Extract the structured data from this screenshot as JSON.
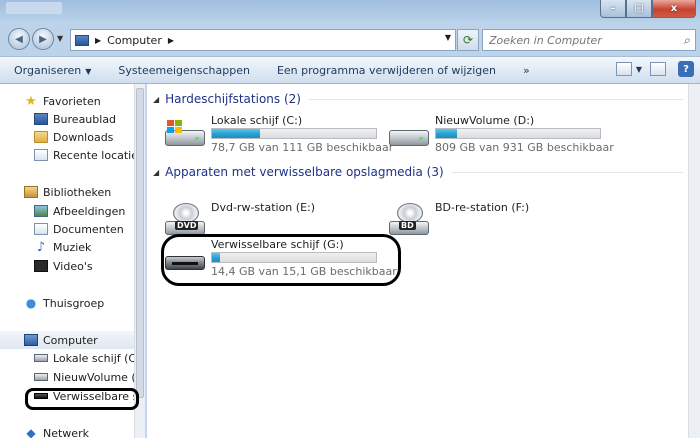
{
  "window": {
    "caption_buttons": {
      "minimize": "–",
      "maximize": "□",
      "close": "x"
    }
  },
  "address_bar": {
    "location": "Computer",
    "search_placeholder": "Zoeken in Computer"
  },
  "toolbar": {
    "organize": "Organiseren",
    "system_properties": "Systeemeigenschappen",
    "uninstall": "Een programma verwijderen of wijzigen",
    "more": "»",
    "help": "?"
  },
  "nav": {
    "favorites": "Favorieten",
    "desktop": "Bureaublad",
    "downloads": "Downloads",
    "recent": "Recente locaties",
    "libraries": "Bibliotheken",
    "pictures": "Afbeeldingen",
    "documents": "Documenten",
    "music": "Muziek",
    "videos": "Video's",
    "homegroup": "Thuisgroep",
    "computer": "Computer",
    "local_disk": "Lokale schijf (C:)",
    "new_volume": "NieuwVolume (D",
    "removable": "Verwisselbare sch",
    "network": "Netwerk"
  },
  "content": {
    "hdd_header": "Hardeschijfstations (2)",
    "removable_header": "Apparaten met verwisselbare opslagmedia (3)",
    "drives": [
      {
        "name": "Lokale schijf (C:)",
        "free_text": "78,7 GB van 111 GB beschikbaar",
        "used_fraction": 0.29
      },
      {
        "name": "NieuwVolume (D:)",
        "free_text": "809 GB van 931 GB beschikbaar",
        "used_fraction": 0.13
      },
      {
        "name": "Dvd-rw-station (E:)",
        "icon_label": "DVD"
      },
      {
        "name": "BD-re-station (F:)",
        "icon_label": "BD"
      },
      {
        "name": "Verwisselbare schijf (G:)",
        "free_text": "14,4 GB van 15,1 GB beschikbaar",
        "used_fraction": 0.05
      }
    ]
  },
  "colors": {
    "bar_fill": "#25a1d1",
    "group_header_text": "#1e3287",
    "annotation_circle": "#000000"
  }
}
